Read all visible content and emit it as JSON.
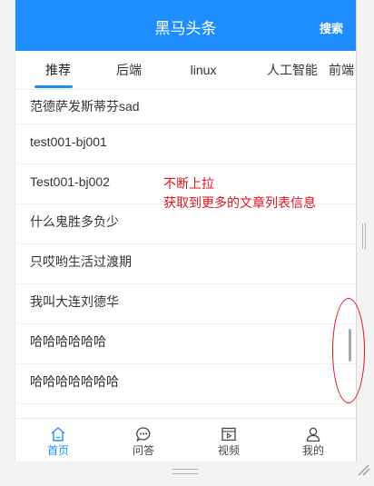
{
  "navbar": {
    "title": "黑马头条",
    "search_label": "搜索"
  },
  "tabs": [
    {
      "label": "推荐",
      "active": true
    },
    {
      "label": "后端",
      "active": false
    },
    {
      "label": "linux",
      "active": false
    },
    {
      "label": "人工智能",
      "active": false
    },
    {
      "label": "前端",
      "active": false
    }
  ],
  "articles": [
    "范德萨发斯蒂芬sad",
    "test001-bj001",
    "Test001-bj002",
    "什么鬼胜多负少",
    "只哎哟生活过渡期",
    "我叫大连刘德华",
    "哈哈哈哈哈哈",
    "哈哈哈哈哈哈哈"
  ],
  "tabbar": [
    {
      "label": "首页",
      "icon": "home-icon",
      "active": true
    },
    {
      "label": "问答",
      "icon": "chat-icon",
      "active": false
    },
    {
      "label": "视频",
      "icon": "video-icon",
      "active": false
    },
    {
      "label": "我的",
      "icon": "user-icon",
      "active": false
    }
  ],
  "annotation": {
    "line1": "不断上拉",
    "line2": "获取到更多的文章列表信息"
  },
  "colors": {
    "brand": "#1e8eff",
    "annotation": "#e0141e"
  }
}
